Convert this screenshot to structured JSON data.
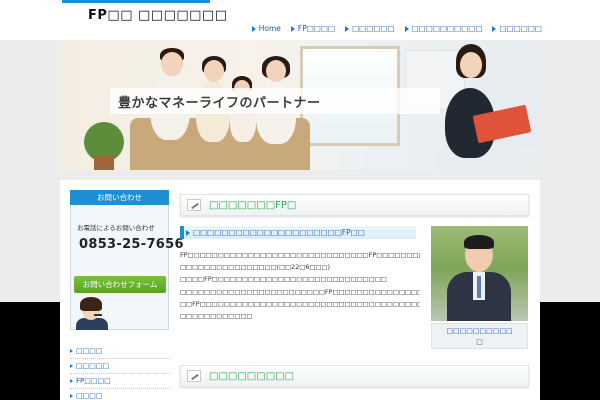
{
  "header": {
    "site_title": "FP□□ □□□□□□□",
    "nav": [
      {
        "label": "Home"
      },
      {
        "label": "FP□□□□"
      },
      {
        "label": "□□□□□□"
      },
      {
        "label": "□□□□□□□□□□"
      },
      {
        "label": "□□□□□□"
      }
    ]
  },
  "hero": {
    "slogan": "豊かなマネーライフのパートナー"
  },
  "sidebar": {
    "contact_title": "お問い合わせ",
    "tel_label": "お電話によるお問い合わせ",
    "tel_number": "0853-25-7656",
    "form_button": "お問い合わせフォーム",
    "links": [
      {
        "label": "□□□□"
      },
      {
        "label": "□□□□□"
      },
      {
        "label": "FP□□□□"
      },
      {
        "label": "□□□□"
      }
    ]
  },
  "main": {
    "section1_title": "□□□□□□□FP□",
    "subsection_title": "□□□□□□□□□□□□□□□□□□□□□FP□□",
    "body_lines": [
      "FP□□□□□□□□□□□□□□□□□□□□□□□□□□□□□□FP□□□□□□□□□□□□□□□□□□□□□□□□",
      "□□□□□□□□□□□□□□□□(□□22□6□□□)",
      "□□□□FP□□□□□□□□□□□□□□□□□□□□□□□□□□□□□",
      "□□□□□□□□□□□□□□□□□□□□□□□□FP□□□□□□□□□□□□□□□□□□",
      "□□FP□□□□□□□□□□□□□□□□□□□□□□□□□□□□□□□□□□□□□□□□□□□□□□",
      "□□□□□□□□□□□□"
    ],
    "photo_caption_line1": "□□□□□□□□□□",
    "photo_caption_line2": "□",
    "section2_title": "□□□□□□□□□"
  }
}
